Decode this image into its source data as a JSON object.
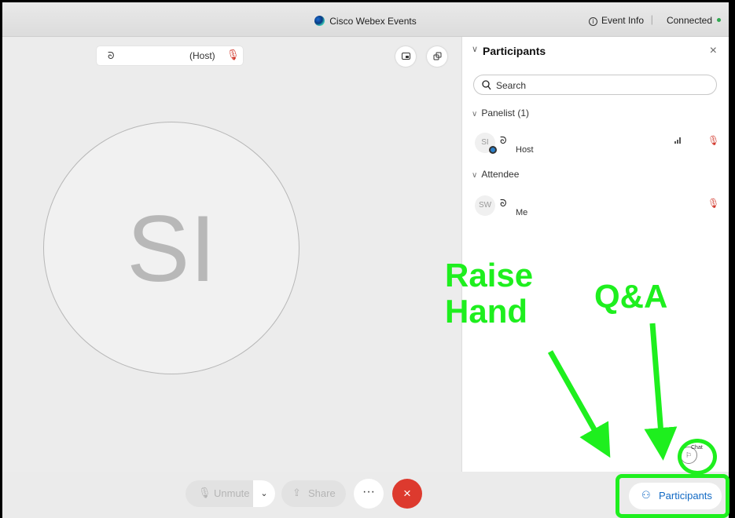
{
  "window": {
    "app_title": "Cisco Webex Events",
    "event_info_label": "Event Info",
    "separator": "|",
    "connection_status": "Connected",
    "status_color": "#2fa84f"
  },
  "stage": {
    "host_label": "(Host)",
    "avatar_initials": "SI",
    "icons": [
      "headset-icon",
      "mic-muted-icon",
      "picture-in-picture-icon",
      "pop-out-icon"
    ]
  },
  "panel": {
    "title": "Participants",
    "close_glyph": "×",
    "search_placeholder": "Search",
    "groups": [
      {
        "label": "Panelist (1)",
        "participants": [
          {
            "initials": "SI",
            "name": "Host",
            "muted": true,
            "signal": true
          }
        ]
      },
      {
        "label": "Attendee",
        "participants": [
          {
            "initials": "SW",
            "name": "Me",
            "muted": true,
            "signal": false
          }
        ]
      }
    ],
    "chat_label": "Chat"
  },
  "controls": {
    "unmute_label": "Unmute",
    "share_label": "Share",
    "more_glyph": "···",
    "leave_glyph": "×",
    "participants_label": "Participants",
    "leave_color": "#dd3a2e",
    "accent_color": "#1169c4"
  },
  "annotations": {
    "raise_hand": "Raise Hand",
    "qa": "Q&A",
    "color": "#1eef1e"
  }
}
